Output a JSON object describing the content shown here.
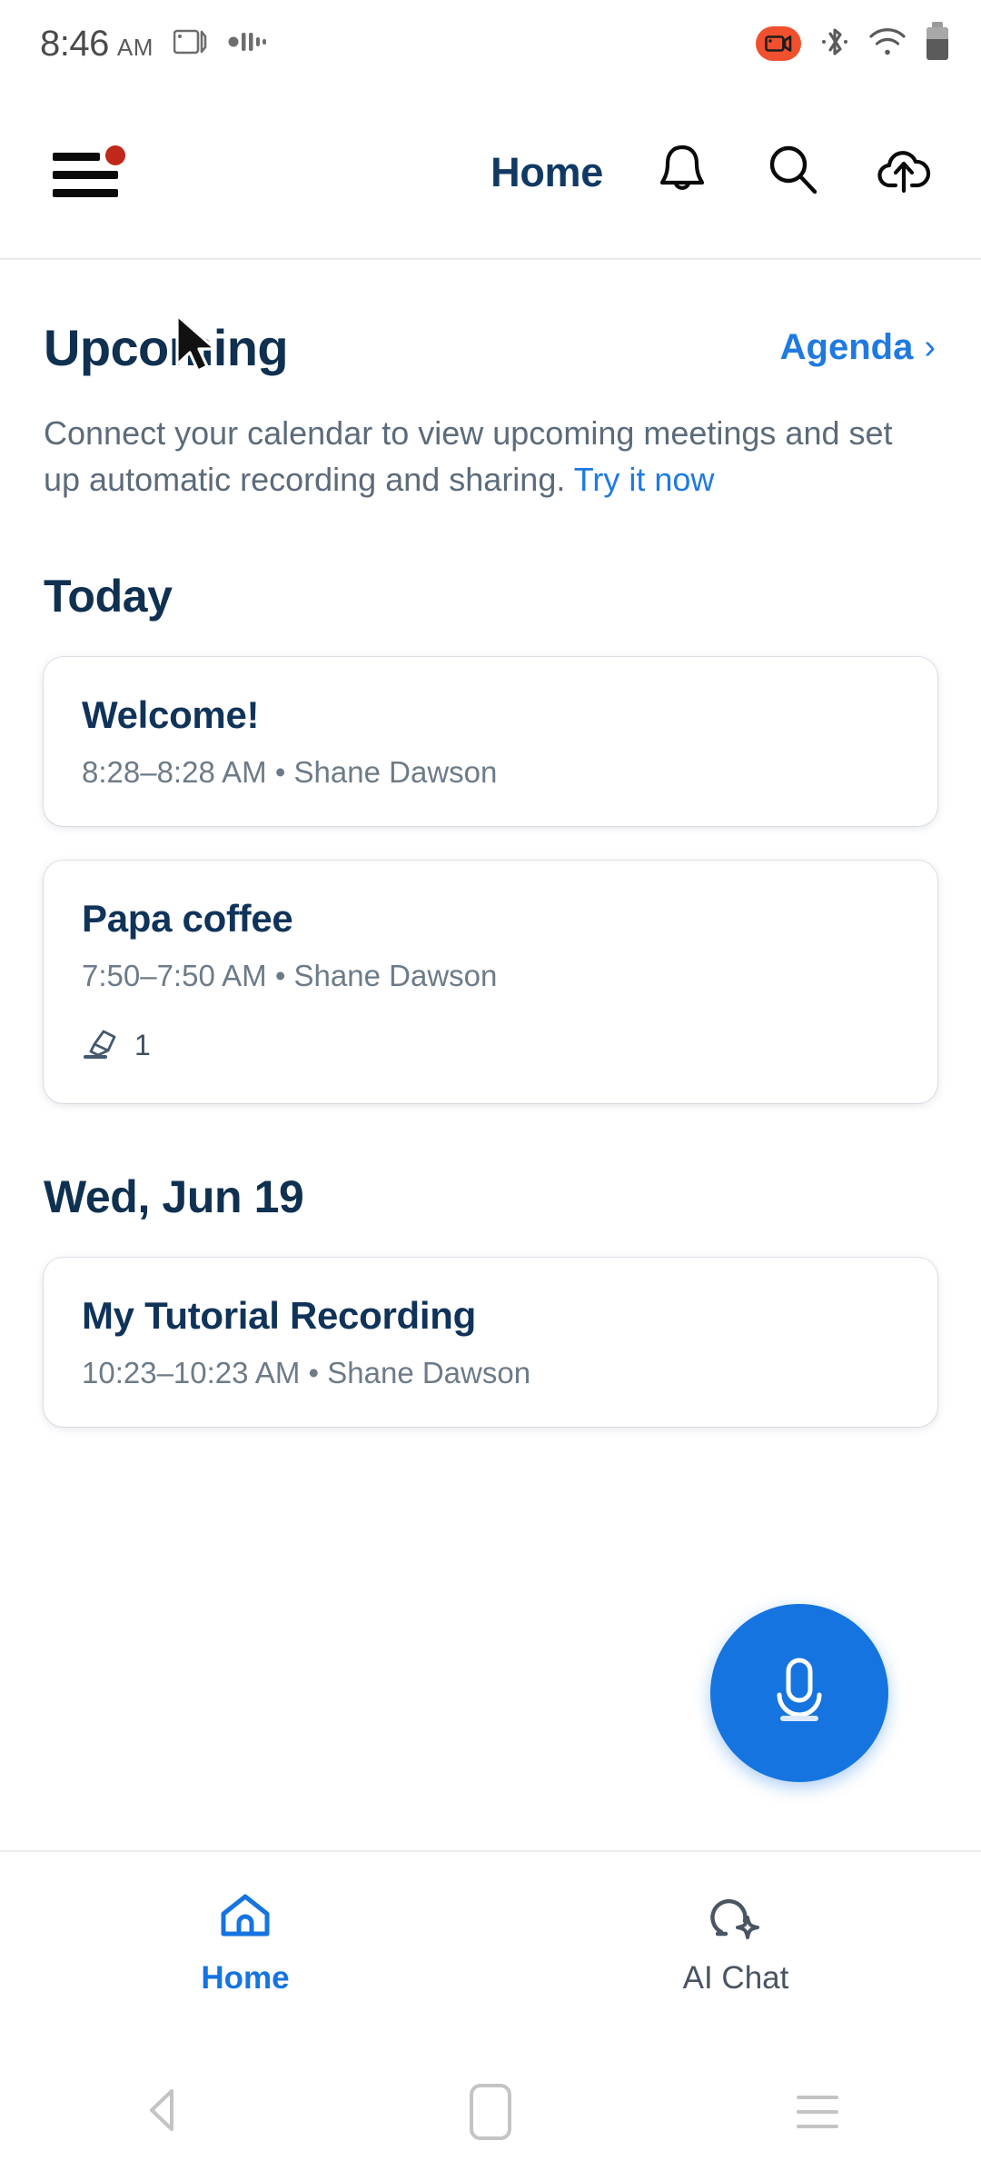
{
  "status_bar": {
    "time": "8:46",
    "ampm": "AM",
    "icons": [
      "screen-cast-icon",
      "audio-waveform-icon",
      "screen-record-badge",
      "bluetooth-icon",
      "wifi-icon",
      "battery-icon"
    ],
    "recording_color": "#f0502e"
  },
  "app_bar": {
    "menu_badge": true,
    "title": "Home",
    "icons": [
      "bell-icon",
      "search-icon",
      "cloud-upload-icon"
    ]
  },
  "upcoming": {
    "heading": "Upcoming",
    "agenda_label": "Agenda",
    "agenda_chevron": "›",
    "blurb_text": "Connect your calendar to view upcoming meetings and set up automatic recording and sharing. ",
    "blurb_link": "Try it now"
  },
  "sections": [
    {
      "header": "Today",
      "cards": [
        {
          "title": "Welcome!",
          "subtitle": "8:28–8:28 AM •  Shane Dawson",
          "meta_count": null
        },
        {
          "title": "Papa coffee",
          "subtitle": "7:50–7:50 AM •  Shane Dawson",
          "meta_count": "1"
        }
      ]
    },
    {
      "header": "Wed, Jun 19",
      "cards": [
        {
          "title": "My Tutorial Recording",
          "subtitle": "10:23–10:23 AM •  Shane Dawson",
          "meta_count": null
        }
      ]
    }
  ],
  "fab": {
    "icon": "microphone-icon",
    "color": "#1574e0"
  },
  "bottom_nav": {
    "items": [
      {
        "label": "Home",
        "icon": "home-icon",
        "active": true
      },
      {
        "label": "AI Chat",
        "icon": "ai-chat-icon",
        "active": false
      }
    ],
    "active_color": "#1574e0",
    "inactive_color": "#4a5562"
  },
  "system_nav": {
    "back": "back-triangle-icon",
    "home": "home-square-icon",
    "recents": "recents-lines-icon"
  },
  "colors": {
    "heading_navy": "#0f3050",
    "link_blue": "#1f7ae0",
    "body_gray": "#5c6b7a"
  }
}
